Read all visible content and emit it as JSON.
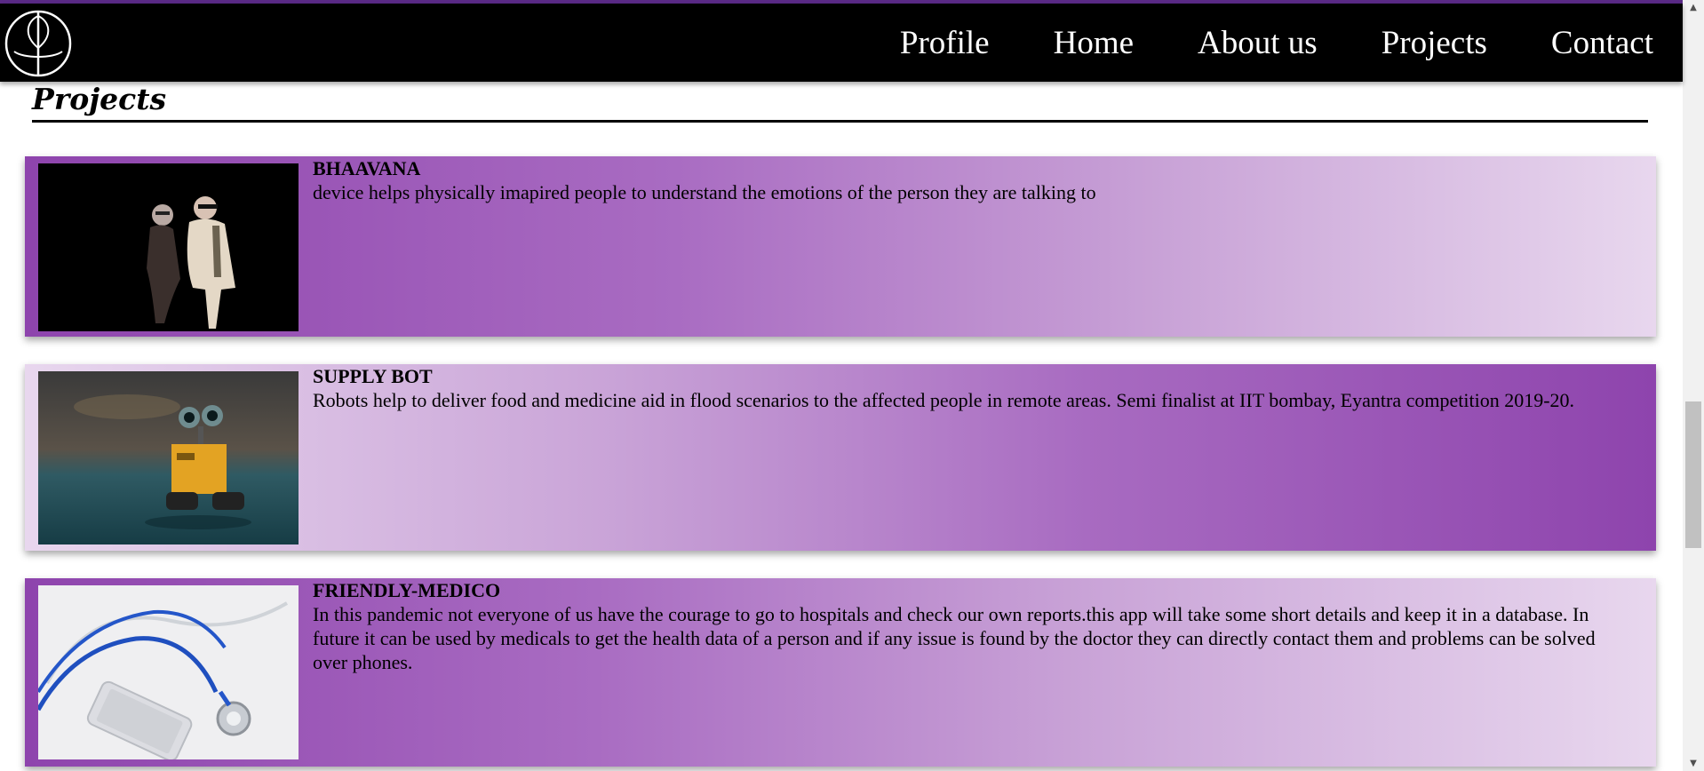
{
  "header": {
    "logo_icon": "circle-monogram-logo",
    "nav": [
      {
        "label": "Profile"
      },
      {
        "label": "Home"
      },
      {
        "label": "About us"
      },
      {
        "label": "Projects"
      },
      {
        "label": "Contact"
      }
    ],
    "colors": {
      "bar": "#000000",
      "accent_strip": "#5a2a86",
      "text": "#ffffff"
    }
  },
  "main": {
    "section_title": "Projects",
    "projects": [
      {
        "title": "BHAAVANA",
        "description": "device helps physically imapired people to understand the emotions of the person they are talking to",
        "image_icon": "elderly-couple-photo"
      },
      {
        "title": "SUPPLY BOT",
        "description": "Robots help to deliver food and medicine aid in flood scenarios to the affected people in remote areas. Semi finalist at IIT bombay, Eyantra competition 2019-20.",
        "image_icon": "robot-toy-photo"
      },
      {
        "title": "FRIENDLY-MEDICO",
        "description": "In this pandemic not everyone of us have the courage to go to hospitals and check our own reports.this app will take some short details and keep it in a database. In future it can be used by medicals to get the health data of a person and if any issue is found by the doctor they can directly contact them and problems can be solved over phones.",
        "image_icon": "stethoscope-phone-photo"
      }
    ],
    "colors": {
      "card_purple": "#8e44ad",
      "card_light": "#e8d7ee"
    }
  },
  "scrollbar": {
    "up_icon": "triangle-up-icon",
    "down_icon": "triangle-down-icon"
  }
}
